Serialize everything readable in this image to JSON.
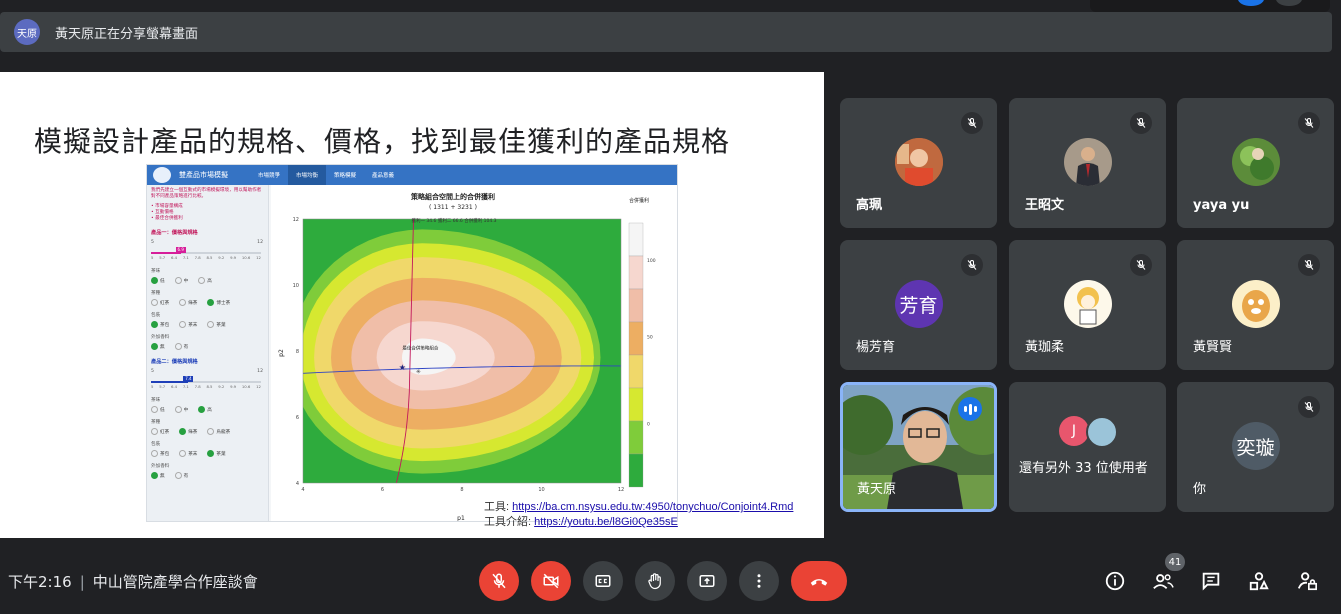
{
  "banner": {
    "presenter_avatar": "天原",
    "share_text": "黃天原正在分享螢幕畫面"
  },
  "slide": {
    "title": "模擬設計產品的規格、價格，找到最佳獲利的產品規格",
    "app": {
      "brand": "雙產品市場模擬",
      "tabs": [
        "市場競爭",
        "市場均衡",
        "策略模擬",
        "產品意義"
      ],
      "intro": "我們先建立一個互動式的市場模擬環境，用以幫助作者對不同產品策略進行比較。",
      "bullets": [
        "• 市場容量構成",
        "• 互動價格",
        "• 最佳合併獲利"
      ],
      "product1_header": "產品一：價格與規格",
      "product2_header": "產品二：價格與規格",
      "slider_ticks": [
        "5",
        "5.7",
        "6.4",
        "7.1",
        "7.8",
        "8.5",
        "9.2",
        "9.9",
        "10.6",
        "12"
      ],
      "slider1_range": [
        "5",
        "12"
      ],
      "slider1_value": "6.9",
      "slider1_fraction": 0.27,
      "slider2_range": [
        "5",
        "12"
      ],
      "slider2_value": "7.4",
      "slider2_fraction": 0.34,
      "labels": {
        "tea": "茶味",
        "sweet": "茶種",
        "pack": "包裝",
        "extra": "外加香料"
      },
      "p1_tea": [
        "低",
        "中",
        "高"
      ],
      "p1_sweet": [
        "紅茶",
        "綠茶",
        "博士茶"
      ],
      "p1_pack": [
        "茶包",
        "茶末",
        "茶葉"
      ],
      "p1_extra": [
        "無",
        "有"
      ],
      "p2_tea": [
        "低",
        "中",
        "高"
      ],
      "p2_sweet": [
        "紅茶",
        "綠茶",
        "烏龍茶"
      ],
      "p2_pack": [
        "茶包",
        "茶末",
        "茶葉"
      ],
      "p2_extra": [
        "無",
        "有"
      ]
    },
    "tool_label": "工具: ",
    "tool_url": "https://ba.cm.nsysu.edu.tw:4950/tonychuo/Conjoint4.Rmd",
    "intro_label": "工具介紹: ",
    "intro_url": "https://youtu.be/l8Gi0Qe35sE"
  },
  "chart_data": {
    "type": "heatmap",
    "title": "策略組合空間上的合併獲利",
    "subtitle": "( 1311 + 3231 )",
    "annotation": "獲利一 34.6 獲利二 66.6 合併獲利 104.3",
    "point_label": "最佳合併策略組合",
    "xlabel": "p1",
    "ylabel": "p2",
    "xlim": [
      4,
      12
    ],
    "ylim": [
      4,
      12
    ],
    "x_ticks": [
      "4",
      "6",
      "8",
      "10",
      "12"
    ],
    "y_ticks": [
      "4",
      "6",
      "8",
      "10",
      "12"
    ],
    "optimum": [
      6.5,
      7.5
    ],
    "legend_title": "合併獲利",
    "legend_ticks": [
      "100",
      "50",
      "0"
    ],
    "colors": [
      "#2eab3d",
      "#7fcc3a",
      "#d6e830",
      "#f0d86a",
      "#edae62",
      "#f0bea8",
      "#f6d7cf",
      "#f5f5f5"
    ]
  },
  "participants": [
    {
      "name": "高珮",
      "type": "photo",
      "muted": true
    },
    {
      "name": "王昭文",
      "type": "photo",
      "muted": true
    },
    {
      "name": "yaya yu",
      "type": "photo",
      "muted": true
    },
    {
      "name": "楊芳育",
      "type": "letter",
      "initials": "芳育",
      "muted": true
    },
    {
      "name": "黃珈柔",
      "type": "photo",
      "muted": true
    },
    {
      "name": "黃賢賢",
      "type": "photo",
      "muted": true
    },
    {
      "name": "黃天原",
      "type": "video",
      "muted": false
    },
    {
      "name": "還有另外 33 位使用者",
      "type": "more",
      "initial": "J"
    },
    {
      "name": "你",
      "type": "letter",
      "initials": "奕璇",
      "muted": true
    }
  ],
  "bottom": {
    "time": "下午2:16",
    "meeting": "中山管院產學合作座談會",
    "people_count": "41"
  },
  "colors": {
    "bg": "#202124",
    "tile": "#3c4043",
    "red": "#ea4335",
    "accent": "#8ab4f8"
  }
}
